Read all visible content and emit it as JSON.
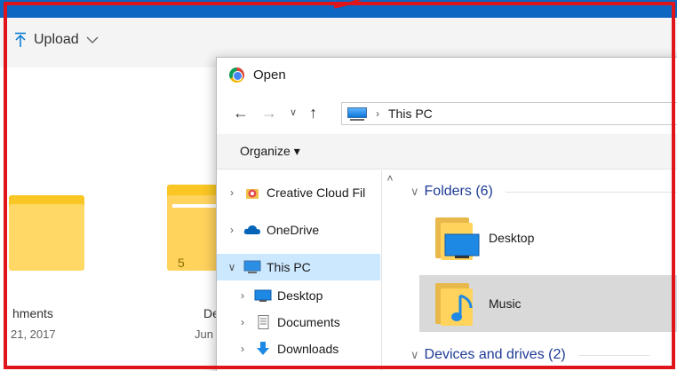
{
  "background_app": {
    "upload_label": "Upload",
    "items": [
      {
        "name": "hments",
        "date": "21, 2017"
      },
      {
        "name": "De",
        "date": "Jun",
        "count": "5"
      }
    ]
  },
  "dialog": {
    "title": "Open",
    "address": {
      "location": "This PC"
    },
    "organize_label": "Organize ▾",
    "nav_tree": [
      {
        "label": "Creative Cloud Fil",
        "icon": "creative-cloud-icon"
      },
      {
        "label": "OneDrive",
        "icon": "onedrive-cloud-icon"
      },
      {
        "label": "This PC",
        "icon": "this-pc-icon",
        "selected": true
      },
      {
        "label": "Desktop",
        "icon": "desktop-icon"
      },
      {
        "label": "Documents",
        "icon": "documents-icon"
      },
      {
        "label": "Downloads",
        "icon": "downloads-icon"
      }
    ],
    "groups": {
      "folders": "Folders (6)",
      "devices": "Devices and drives (2)"
    },
    "tiles": [
      {
        "label": "Desktop",
        "icon": "desktop-folder-icon"
      },
      {
        "label": "Music",
        "icon": "music-folder-icon",
        "selected": true
      }
    ]
  },
  "colors": {
    "highlight": "#e0151b",
    "topbar": "#0d66c2",
    "selection": "#cce8ff",
    "tile_selection": "#d9d9d9",
    "group_header": "#1e3b96"
  }
}
